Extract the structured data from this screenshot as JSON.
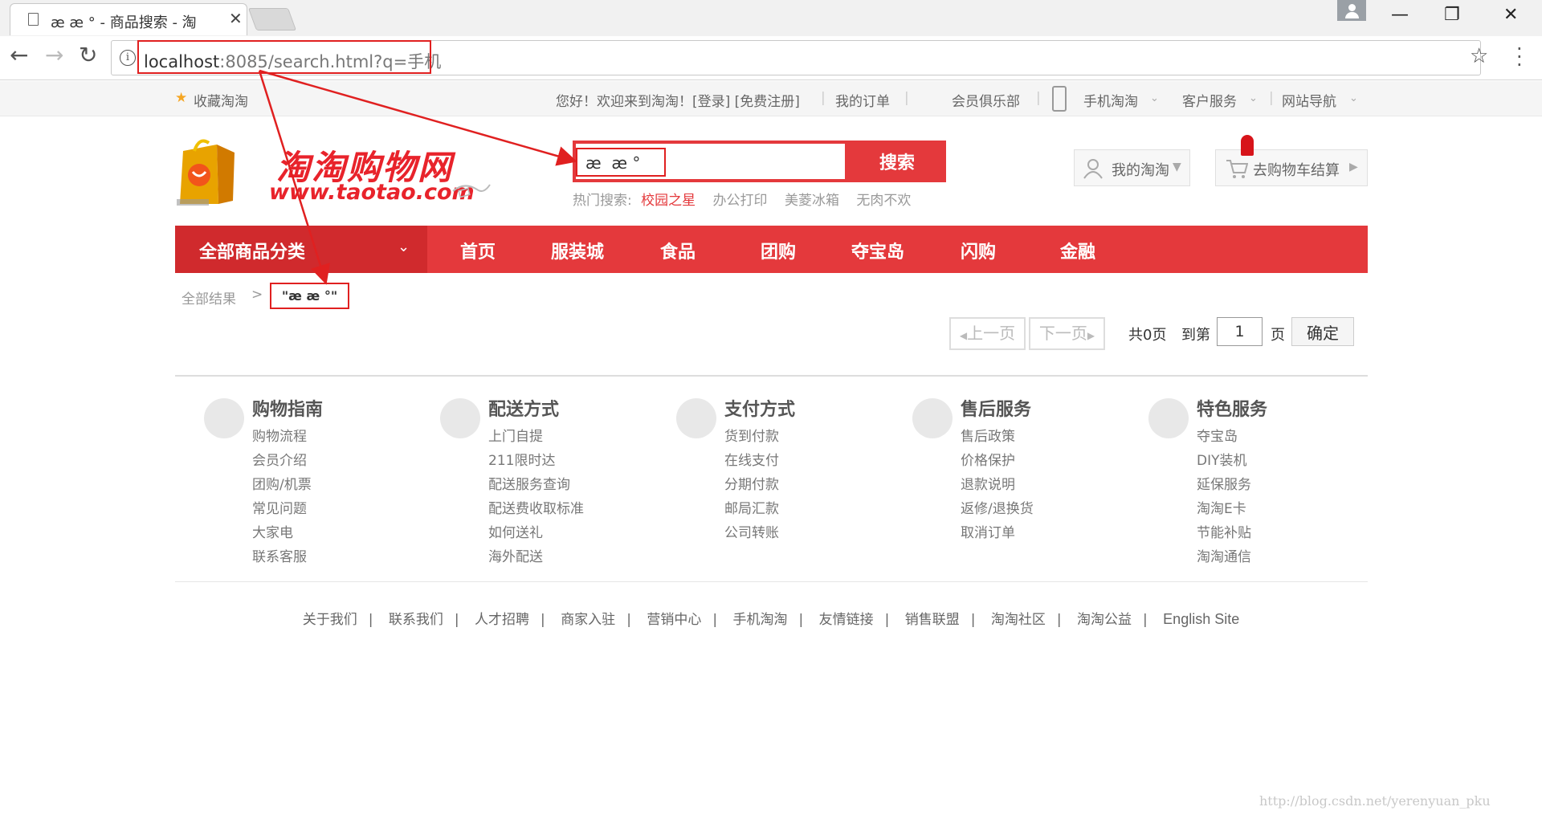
{
  "browser": {
    "tab_title": "æ  æ ° - 商品搜索 - 淘",
    "tab_close": "✕",
    "url_host": "localhost",
    "url_rest": ":8085/search.html?q=手机",
    "back": "←",
    "forward": "→",
    "reload": "↻",
    "info": "i",
    "bookmark_star": "☆",
    "minimize": "—",
    "restore": "❐",
    "close": "✕"
  },
  "topbar": {
    "favorite": "收藏淘淘",
    "greeting": "您好！欢迎来到淘淘！[登录] [免费注册]",
    "my_orders": "我的订单",
    "member_club": "会员俱乐部",
    "mobile_taotao": "手机淘淘",
    "customer_service": "客户服务",
    "site_nav": "网站导航"
  },
  "header": {
    "logo_text": "淘淘购物网",
    "logo_url": "www.taotao.com",
    "search_value": "æ  æ °",
    "search_button": "搜索",
    "hot_label": "热门搜索:",
    "hot_items": [
      "校园之星",
      "办公打印",
      "美菱冰箱",
      "无肉不欢"
    ],
    "my_taotao": "我的淘淘",
    "cart": "去购物车结算"
  },
  "nav": {
    "all_categories": "全部商品分类",
    "items": [
      "首页",
      "服装城",
      "食品",
      "团购",
      "夺宝岛",
      "闪购",
      "金融"
    ]
  },
  "breadcrumb": {
    "all_results": "全部结果",
    "sep": ">",
    "keyword": "\"æ  æ °\""
  },
  "pagination": {
    "prev": "上一页",
    "next": "下一页",
    "total": "共0页",
    "goto": "到第",
    "page_value": "1",
    "page_unit": "页",
    "confirm": "确定"
  },
  "help": [
    {
      "title": "购物指南",
      "links": [
        "购物流程",
        "会员介绍",
        "团购/机票",
        "常见问题",
        "大家电",
        "联系客服"
      ]
    },
    {
      "title": "配送方式",
      "links": [
        "上门自提",
        "211限时达",
        "配送服务查询",
        "配送费收取标准",
        "如何送礼",
        "海外配送"
      ]
    },
    {
      "title": "支付方式",
      "links": [
        "货到付款",
        "在线支付",
        "分期付款",
        "邮局汇款",
        "公司转账"
      ]
    },
    {
      "title": "售后服务",
      "links": [
        "售后政策",
        "价格保护",
        "退款说明",
        "返修/退换货",
        "取消订单"
      ]
    },
    {
      "title": "特色服务",
      "links": [
        "夺宝岛",
        "DIY装机",
        "延保服务",
        "淘淘E卡",
        "节能补贴",
        "淘淘通信"
      ]
    }
  ],
  "footer_links": [
    "关于我们",
    "联系我们",
    "人才招聘",
    "商家入驻",
    "营销中心",
    "手机淘淘",
    "友情链接",
    "销售联盟",
    "淘淘社区",
    "淘淘公益",
    "English Site"
  ],
  "watermark": "http://blog.csdn.net/yerenyuan_pku",
  "colors": {
    "brand_red": "#e4393c",
    "annotation_red": "#e02020"
  }
}
